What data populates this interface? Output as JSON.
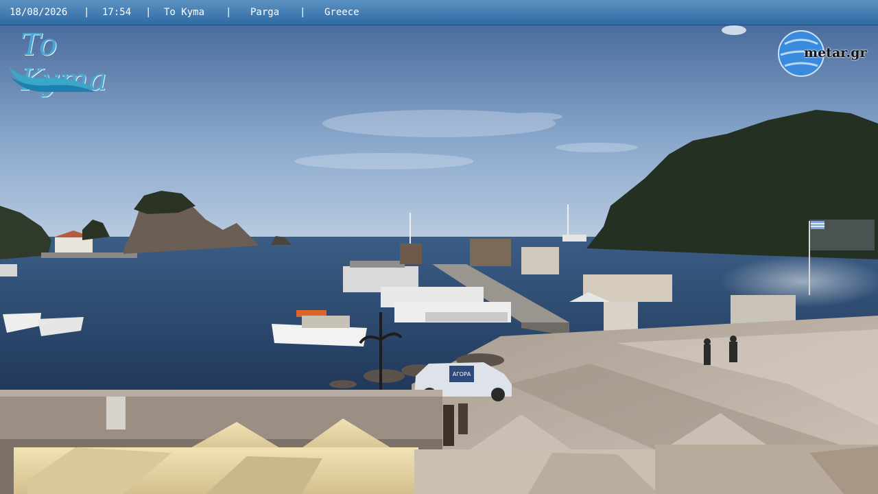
{
  "overlay": {
    "date": "18/08/2026",
    "time": "17:54",
    "venue": "To Kyma",
    "town": "Parga",
    "country": "Greece",
    "separator": "|"
  },
  "logos": {
    "left_brand": "To Kyma",
    "right_brand": "metar.gr"
  },
  "sign_text": "ΑΓΟΡΑ",
  "colors": {
    "banner": "#3a76ae",
    "sky_top": "#4f6f9f",
    "sea": "#2c4c74",
    "island": "#2b3325",
    "plaza": "#b7a99c",
    "umbrella": "#e6d7a6"
  }
}
